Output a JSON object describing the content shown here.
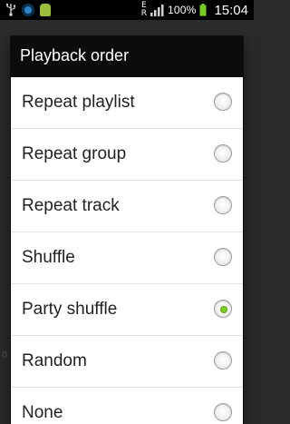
{
  "status_bar": {
    "network_label": "E",
    "network_sub_label": "R",
    "battery_text": "100%",
    "time": "15:04",
    "icons": [
      "usb-icon",
      "app-icon",
      "android-icon",
      "signal-icon",
      "battery-icon"
    ]
  },
  "dialog": {
    "title": "Playback order",
    "options": [
      {
        "label": "Repeat playlist",
        "selected": false
      },
      {
        "label": "Repeat group",
        "selected": false
      },
      {
        "label": "Repeat track",
        "selected": false
      },
      {
        "label": "Shuffle",
        "selected": false
      },
      {
        "label": "Party shuffle",
        "selected": true
      },
      {
        "label": "Random",
        "selected": false
      },
      {
        "label": "None",
        "selected": false
      }
    ],
    "selected_color": "#7acb2a"
  }
}
